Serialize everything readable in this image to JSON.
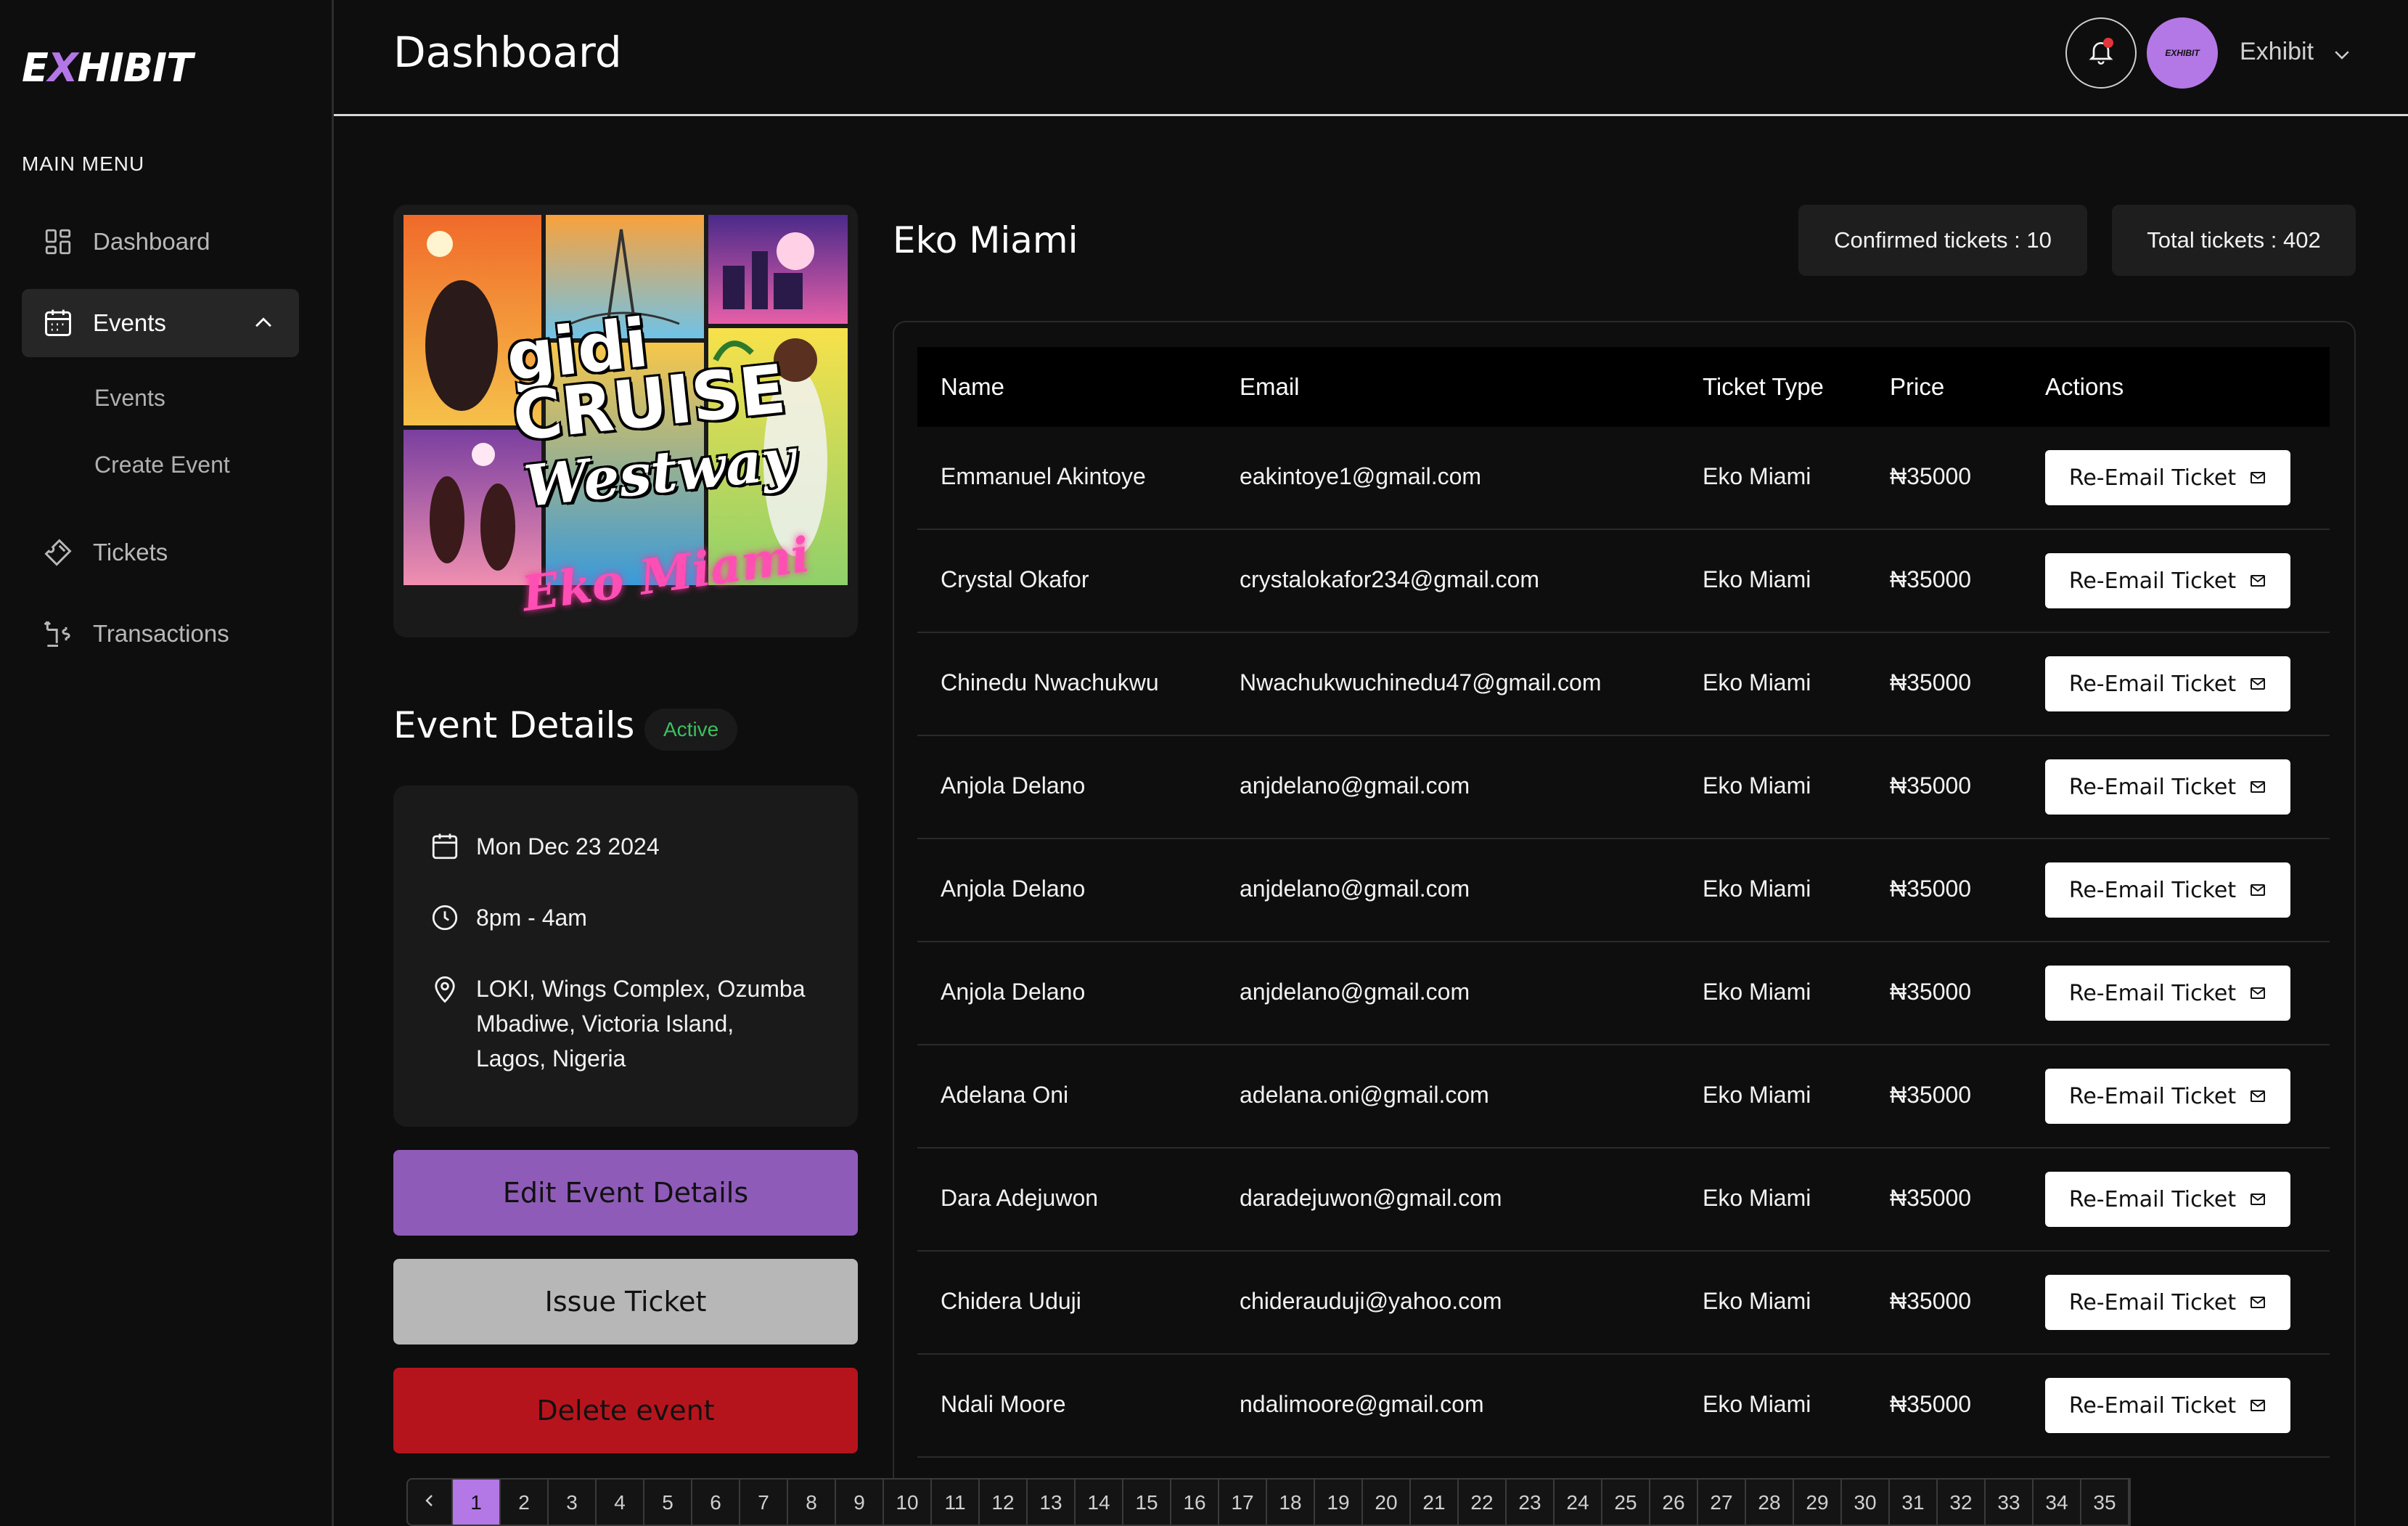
{
  "brand": {
    "logo_prefix": "E",
    "logo_x": "X",
    "logo_suffix": "HIBIT",
    "accent": "#b377e6"
  },
  "sidebar": {
    "menu_title": "MAIN MENU",
    "items": [
      {
        "label": "Dashboard",
        "icon": "grid-icon"
      },
      {
        "label": "Events",
        "icon": "calendar-icon",
        "expanded": true
      },
      {
        "label": "Tickets",
        "icon": "ticket-icon"
      },
      {
        "label": "Transactions",
        "icon": "money-transfer-icon"
      }
    ],
    "sub_items": [
      {
        "label": "Events"
      },
      {
        "label": "Create Event"
      }
    ]
  },
  "header": {
    "title": "Dashboard",
    "user_name": "Exhibit",
    "avatar_text": "EXHIBIT"
  },
  "poster": {
    "line1": "gidi",
    "line2": "CRUISE",
    "line3": "Westway",
    "line4": "Eko Miami"
  },
  "event": {
    "details_title": "Event Details",
    "status": "Active",
    "date": "Mon Dec 23 2024",
    "time": "8pm - 4am",
    "location": "LOKI, Wings Complex, Ozumba Mbadiwe, Victoria Island, Lagos, Nigeria",
    "location_lines": [
      "LOKI, Wings Complex, Ozumba",
      "Mbadiwe, Victoria Island,",
      "Lagos, Nigeria"
    ],
    "name": "Eko Miami",
    "confirmed_tickets": "Confirmed tickets : 10",
    "total_tickets": "Total tickets : 402"
  },
  "buttons": {
    "edit": "Edit Event Details",
    "issue": "Issue Ticket",
    "delete": "Delete event"
  },
  "table": {
    "headers": {
      "name": "Name",
      "email": "Email",
      "ticket_type": "Ticket Type",
      "price": "Price",
      "actions": "Actions"
    },
    "action_label": "Re-Email Ticket",
    "rows": [
      {
        "name": "Emmanuel Akintoye",
        "email": "eakintoye1@gmail.com",
        "type": "Eko Miami",
        "price": "₦35000"
      },
      {
        "name": "Crystal Okafor",
        "email": "crystalokafor234@gmail.com",
        "type": "Eko Miami",
        "price": "₦35000"
      },
      {
        "name": "Chinedu Nwachukwu",
        "email": "Nwachukwuchinedu47@gmail.com",
        "type": "Eko Miami",
        "price": "₦35000"
      },
      {
        "name": "Anjola Delano",
        "email": "anjdelano@gmail.com",
        "type": "Eko Miami",
        "price": "₦35000"
      },
      {
        "name": "Anjola Delano",
        "email": "anjdelano@gmail.com",
        "type": "Eko Miami",
        "price": "₦35000"
      },
      {
        "name": "Anjola Delano",
        "email": "anjdelano@gmail.com",
        "type": "Eko Miami",
        "price": "₦35000"
      },
      {
        "name": "Adelana Oni",
        "email": "adelana.oni@gmail.com",
        "type": "Eko Miami",
        "price": "₦35000"
      },
      {
        "name": "Dara Adejuwon",
        "email": "daradejuwon@gmail.com",
        "type": "Eko Miami",
        "price": "₦35000"
      },
      {
        "name": "Chidera Uduji",
        "email": "chiderauduji@yahoo.com",
        "type": "Eko Miami",
        "price": "₦35000"
      },
      {
        "name": "Ndali Moore",
        "email": "ndalimoore@gmail.com",
        "type": "Eko Miami",
        "price": "₦35000"
      }
    ]
  },
  "pagination": {
    "current": "1",
    "pages": [
      "1",
      "2",
      "3",
      "4",
      "5",
      "6",
      "7",
      "8",
      "9",
      "10",
      "11",
      "12",
      "13",
      "14",
      "15",
      "16",
      "17",
      "18",
      "19",
      "20",
      "21",
      "22",
      "23",
      "24",
      "25",
      "26",
      "27",
      "28",
      "29",
      "30",
      "31",
      "32",
      "33",
      "34",
      "35"
    ]
  }
}
